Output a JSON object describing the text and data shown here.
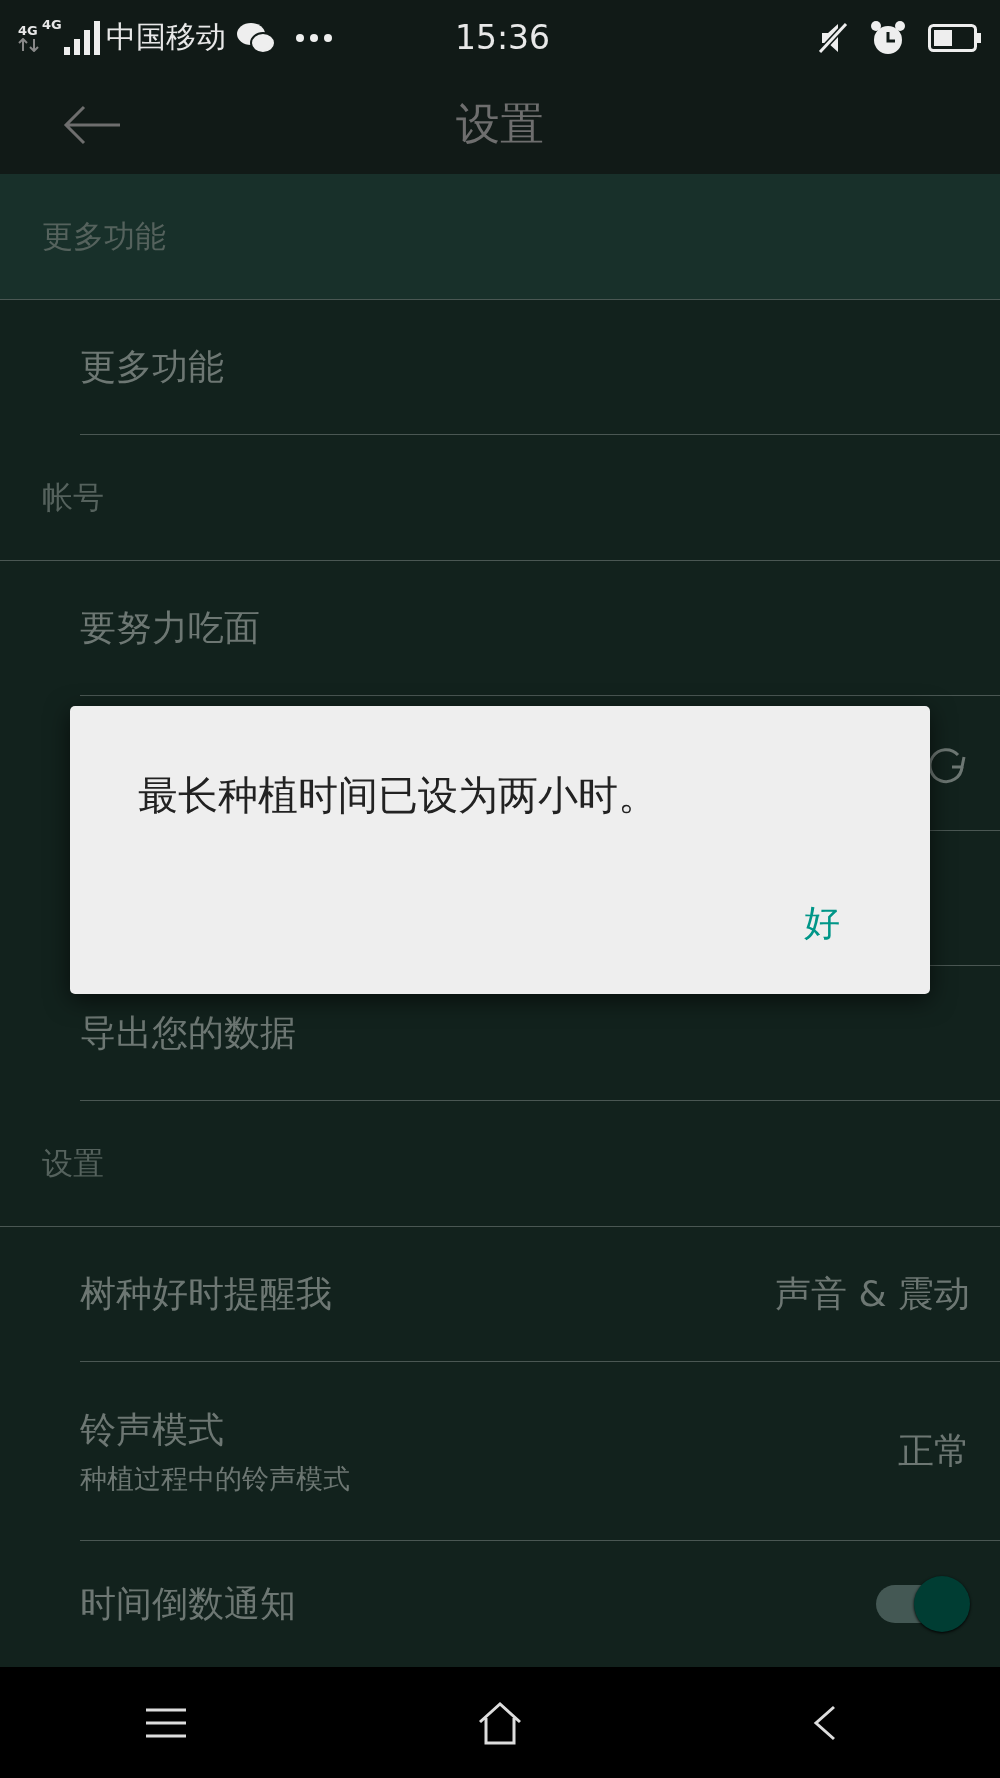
{
  "status_bar": {
    "network_1": "4G",
    "network_2": "4G",
    "carrier": "中国移动",
    "time": "15:36"
  },
  "app_bar": {
    "title": "设置"
  },
  "sections": [
    {
      "header": "更多功能",
      "highlighted": true,
      "items": [
        {
          "kind": "text",
          "label": "更多功能"
        }
      ]
    },
    {
      "header": "帐号",
      "highlighted": false,
      "items": [
        {
          "kind": "text",
          "label": "要努力吃面"
        },
        {
          "kind": "sync"
        },
        {
          "kind": "blank"
        },
        {
          "kind": "text",
          "label": "导出您的数据"
        }
      ]
    },
    {
      "header": "设置",
      "highlighted": false,
      "items": [
        {
          "kind": "value",
          "label": "树种好时提醒我",
          "value": "声音 & 震动"
        },
        {
          "kind": "value",
          "label": "铃声模式",
          "subtitle": "种植过程中的铃声模式",
          "value": "正常"
        },
        {
          "kind": "switch",
          "label": "时间倒数通知",
          "on": true
        }
      ]
    }
  ],
  "dialog": {
    "message": "最长种植时间已设为两小时。",
    "button": "好"
  }
}
